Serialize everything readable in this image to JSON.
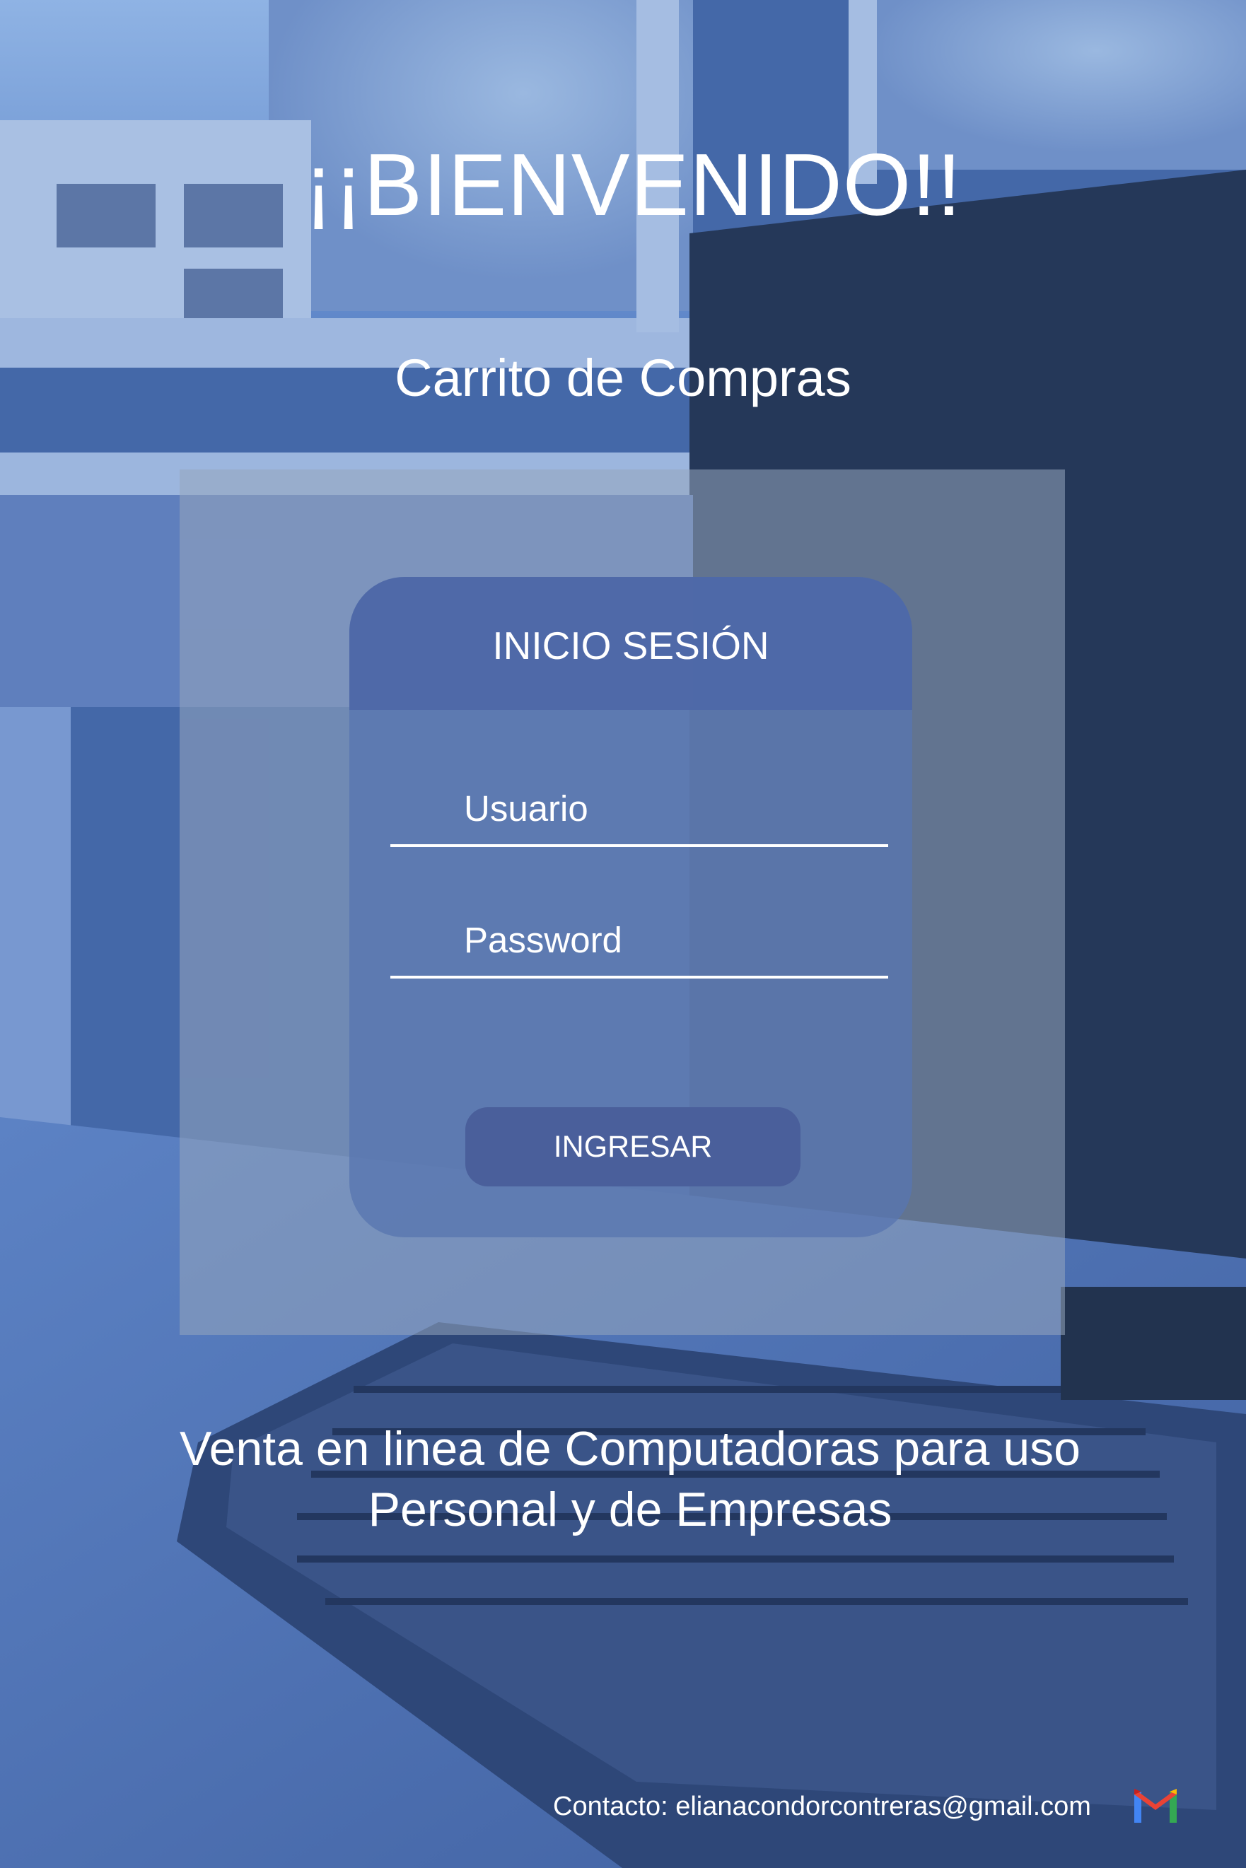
{
  "page": {
    "title": "¡¡BIENVENIDO!!",
    "subtitle": "Carrito de Compras"
  },
  "login": {
    "header": "INICIO SESIÓN",
    "username_placeholder": "Usuario",
    "password_placeholder": "Password",
    "submit_label": "INGRESAR"
  },
  "tagline": {
    "line1": "Venta en linea de Computadoras para uso",
    "line2": "Personal y de Empresas"
  },
  "footer": {
    "contact": "Contacto: elianacondorcontreras@gmail.com",
    "contact_icon": "gmail-icon"
  },
  "colors": {
    "primary": "#4e68a8",
    "button": "#4a5f9b",
    "text": "#ffffff"
  }
}
